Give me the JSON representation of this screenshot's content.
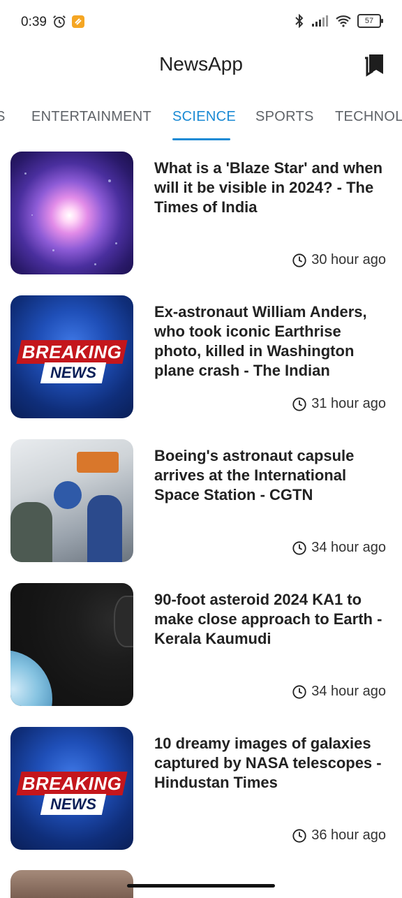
{
  "status_bar": {
    "time": "0:39",
    "battery": "57"
  },
  "app": {
    "title": "NewsApp"
  },
  "tabs": [
    {
      "label": "S"
    },
    {
      "label": "ENTERTAINMENT"
    },
    {
      "label": "SCIENCE"
    },
    {
      "label": "SPORTS"
    },
    {
      "label": "TECHNOLO"
    }
  ],
  "active_tab": "SCIENCE",
  "articles": [
    {
      "headline": "What is a 'Blaze Star' and when will it be visible in 2024? - The Times of India",
      "time": "30 hour ago"
    },
    {
      "headline": "Ex-astronaut William Anders, who took iconic Earthrise photo, killed in Washington plane crash - The Indian",
      "time": "31 hour ago",
      "thumb_text_1": "BREAKING",
      "thumb_text_2": "NEWS"
    },
    {
      "headline": "Boeing's astronaut capsule arrives at the International Space Station - CGTN",
      "time": "34 hour ago"
    },
    {
      "headline": "90-foot asteroid 2024 KA1 to make close approach to Earth - Kerala Kaumudi",
      "time": "34 hour ago"
    },
    {
      "headline": "10 dreamy images of galaxies captured by NASA telescopes - Hindustan Times",
      "time": "36 hour ago",
      "thumb_text_1": "BREAKING",
      "thumb_text_2": "NEWS"
    }
  ],
  "colors": {
    "accent": "#1a8ad4",
    "breaking_red": "#c4161c"
  }
}
